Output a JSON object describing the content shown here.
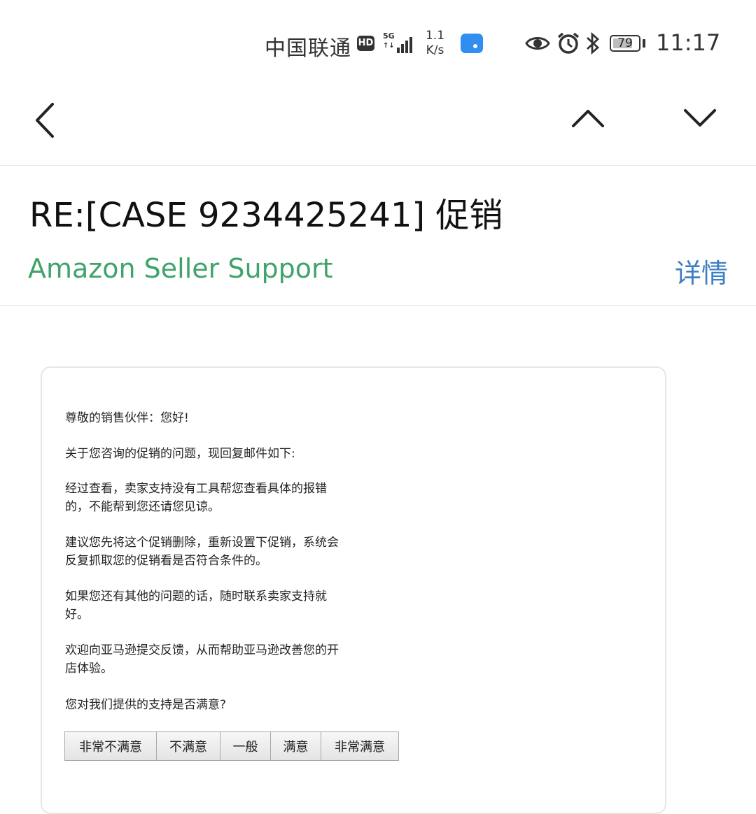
{
  "status_bar": {
    "carrier": "中国联通",
    "hd_badge": "HD",
    "network_type": "5G",
    "network_arrows": "↑↓",
    "speed_value": "1.1",
    "speed_unit": "K/s",
    "battery_percent": "79",
    "battery_level": 0.79,
    "time": "11:17",
    "icons": [
      "signal-icon",
      "message-notification-icon",
      "eye-icon",
      "alarm-icon",
      "bluetooth-icon",
      "battery-icon"
    ]
  },
  "nav": {
    "back_icon": "chevron-left-icon",
    "prev_icon": "chevron-up-icon",
    "next_icon": "chevron-down-icon"
  },
  "header": {
    "subject": "RE:[CASE 9234425241] 促销",
    "sender": "Amazon Seller Support",
    "details_label": "详情",
    "sender_color": "#3fa36a",
    "details_color": "#3e7fc4"
  },
  "email": {
    "paragraphs": [
      "尊敬的销售伙伴：您好!",
      "关于您咨询的促销的问题，现回复邮件如下:",
      "经过查看，卖家支持没有工具帮您查看具体的报错的，不能帮到您还请您见谅。",
      "建议您先将这个促销删除，重新设置下促销，系统会反复抓取您的促销看是否符合条件的。",
      "如果您还有其他的问题的话，随时联系卖家支持就好。",
      "欢迎向亚马逊提交反馈，从而帮助亚马逊改善您的开店体验。",
      "您对我们提供的支持是否满意?"
    ],
    "rating_options": [
      "非常不满意",
      "不满意",
      "一般",
      "满意",
      "非常满意"
    ]
  }
}
